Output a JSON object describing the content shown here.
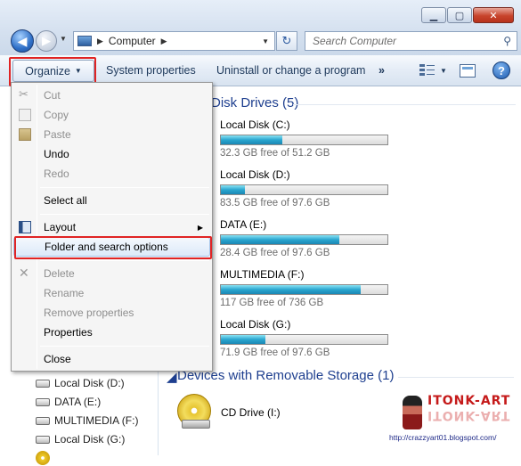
{
  "window": {
    "caption_buttons": [
      "minimize",
      "maximize",
      "close"
    ]
  },
  "address_bar": {
    "breadcrumb": "Computer"
  },
  "search": {
    "placeholder": "Search Computer"
  },
  "toolbar": {
    "organize_label": "Organize",
    "system_properties_label": "System properties",
    "uninstall_label": "Uninstall or change a program",
    "more_label": "»",
    "help_label": "?"
  },
  "organize_menu": {
    "items": [
      {
        "label": "Cut",
        "enabled": false,
        "icon": "scissors-icon"
      },
      {
        "label": "Copy",
        "enabled": false,
        "icon": "copy-icon"
      },
      {
        "label": "Paste",
        "enabled": false,
        "icon": "paste-icon"
      },
      {
        "label": "Undo",
        "enabled": true
      },
      {
        "label": "Redo",
        "enabled": false
      },
      {
        "label": "Select all",
        "enabled": true
      },
      {
        "label": "Layout",
        "enabled": true,
        "icon": "layout-icon",
        "submenu": true
      },
      {
        "label": "Folder and search options",
        "enabled": true,
        "highlighted": true
      },
      {
        "label": "Delete",
        "enabled": false,
        "icon": "delete-icon"
      },
      {
        "label": "Rename",
        "enabled": false
      },
      {
        "label": "Remove properties",
        "enabled": false
      },
      {
        "label": "Properties",
        "enabled": true
      },
      {
        "label": "Close",
        "enabled": true
      }
    ]
  },
  "content": {
    "hard_disk_group": "Disk Drives (5)",
    "drives": [
      {
        "name": "Local Disk (C:)",
        "free": "32.3 GB free of 51.2 GB",
        "used_fraction": 0.37
      },
      {
        "name": "Local Disk (D:)",
        "free": "83.5 GB free of 97.6 GB",
        "used_fraction": 0.145
      },
      {
        "name": "DATA (E:)",
        "free": "28.4 GB free of 97.6 GB",
        "used_fraction": 0.71
      },
      {
        "name": "MULTIMEDIA (F:)",
        "free": "117 GB free of 736 GB",
        "used_fraction": 0.84
      },
      {
        "name": "Local Disk (G:)",
        "free": "71.9 GB free of 97.6 GB",
        "used_fraction": 0.265
      }
    ],
    "removable_group": "Devices with Removable Storage (1)",
    "cd_drive": "CD Drive (I:)"
  },
  "nav_pane": {
    "items": [
      "Local Disk (D:)",
      "DATA (E:)",
      "MULTIMEDIA (F:)",
      "Local Disk (G:)"
    ]
  },
  "watermark": {
    "logo": "ITONK-ART",
    "url": "http://crazzyart01.blogspot.com/"
  },
  "colors": {
    "highlight_box": "#e02424",
    "link_blue": "#1e3f8f",
    "bar_fill": "#2aa6cf"
  }
}
